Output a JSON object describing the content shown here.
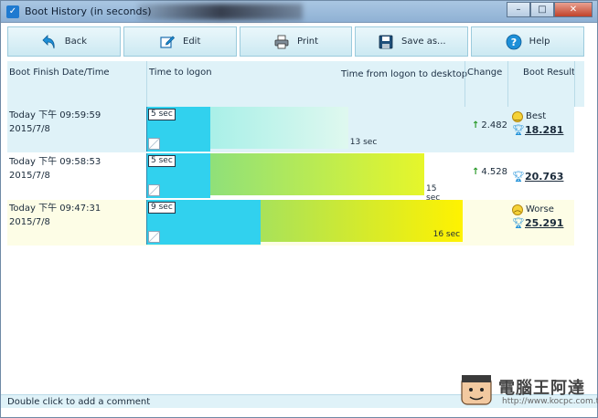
{
  "window": {
    "title": "Boot History (in seconds)"
  },
  "toolbar": {
    "back": "Back",
    "edit": "Edit",
    "print": "Print",
    "save": "Save as...",
    "help": "Help"
  },
  "headers": {
    "date": "Boot Finish Date/Time",
    "logon": "Time to logon",
    "desktop": "Time from logon to desktop",
    "change": "Change",
    "result": "Boot Result"
  },
  "rows": [
    {
      "day": "Today  下午  09:59:59",
      "date": "2015/7/8",
      "logon_label": "5 sec",
      "total_label": "13 sec",
      "change": "2.482",
      "badge": "Best",
      "result": "18.281",
      "logon_seconds": 5,
      "total_seconds": 13,
      "bg": "#dff2f8",
      "bar_from": "#a9f0e8",
      "bar_to": "#dff8ef"
    },
    {
      "day": "Today  下午  09:58:53",
      "date": "2015/7/8",
      "logon_label": "5 sec",
      "total_label": "15 sec",
      "change": "4.528",
      "badge": "",
      "result": "20.763",
      "logon_seconds": 5,
      "total_seconds": 15,
      "bg": "#ffffff",
      "bar_from": "#8fe07a",
      "bar_to": "#e6f62a"
    },
    {
      "day": "Today  下午  09:47:31",
      "date": "2015/7/8",
      "logon_label": "9 sec",
      "total_label": "16 sec",
      "change": "",
      "badge": "Worse",
      "result": "25.291",
      "logon_seconds": 9,
      "total_seconds": 16,
      "bg": "#fdfde6",
      "bar_from": "#a8e25a",
      "bar_to": "#fff200"
    }
  ],
  "status": {
    "text": "Double click to add a comment"
  },
  "watermark": {
    "name": "電腦王阿達",
    "url": "http://www.kocpc.com.tw"
  },
  "colors": {
    "logon_bar": "#31d1ee",
    "accent": "#1f7ad0"
  }
}
